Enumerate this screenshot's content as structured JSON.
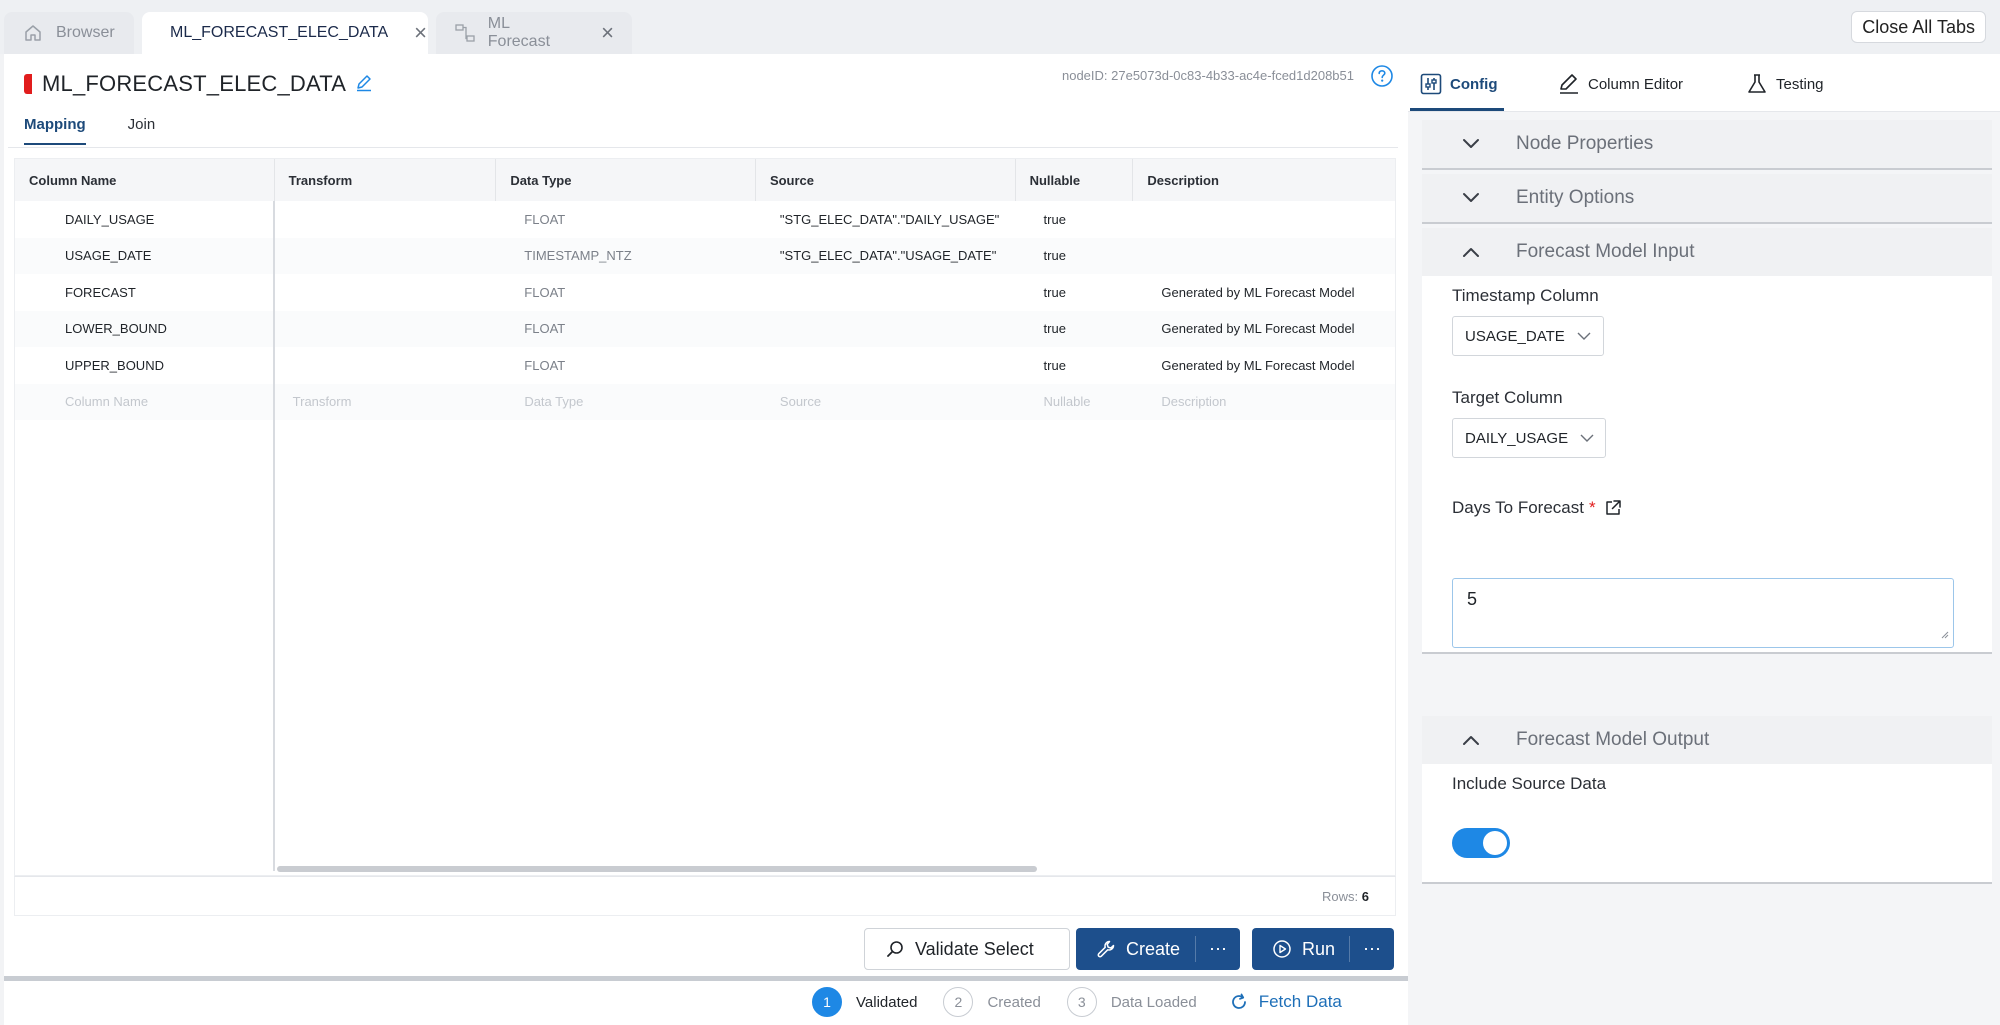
{
  "tabs": {
    "browser": "Browser",
    "active": "ML_FORECAST_ELEC_DATA",
    "ml_forecast": "ML Forecast",
    "close_all": "Close All Tabs"
  },
  "header": {
    "title": "ML_FORECAST_ELEC_DATA",
    "node_id": "nodeID: 27e5073d-0c83-4b33-ac4e-fced1d208b51"
  },
  "subtabs": {
    "mapping": "Mapping",
    "join": "Join"
  },
  "grid": {
    "columns": [
      "Column Name",
      "Transform",
      "Data Type",
      "Source",
      "Nullable",
      "Description"
    ],
    "rows": [
      {
        "name": "DAILY_USAGE",
        "transform": "",
        "type": "FLOAT",
        "source": "\"STG_ELEC_DATA\".\"DAILY_USAGE\"",
        "nullable": "true",
        "description": ""
      },
      {
        "name": "USAGE_DATE",
        "transform": "",
        "type": "TIMESTAMP_NTZ",
        "source": "\"STG_ELEC_DATA\".\"USAGE_DATE\"",
        "nullable": "true",
        "description": ""
      },
      {
        "name": "FORECAST",
        "transform": "",
        "type": "FLOAT",
        "source": "",
        "nullable": "true",
        "description": "Generated by ML Forecast Model"
      },
      {
        "name": "LOWER_BOUND",
        "transform": "",
        "type": "FLOAT",
        "source": "",
        "nullable": "true",
        "description": "Generated by ML Forecast Model"
      },
      {
        "name": "UPPER_BOUND",
        "transform": "",
        "type": "FLOAT",
        "source": "",
        "nullable": "true",
        "description": "Generated by ML Forecast Model"
      }
    ],
    "placeholder": {
      "name": "Column Name",
      "transform": "Transform",
      "type": "Data Type",
      "source": "Source",
      "nullable": "Nullable",
      "description": "Description"
    },
    "rows_label": "Rows:",
    "rows_count": "6"
  },
  "actions": {
    "validate": "Validate Select",
    "create": "Create",
    "run": "Run",
    "more": "⋯"
  },
  "status": {
    "steps": [
      {
        "num": "1",
        "label": "Validated"
      },
      {
        "num": "2",
        "label": "Created"
      },
      {
        "num": "3",
        "label": "Data Loaded"
      }
    ],
    "fetch": "Fetch Data"
  },
  "right": {
    "tabs": {
      "config": "Config",
      "column_editor": "Column Editor",
      "testing": "Testing"
    },
    "sections": {
      "node_properties": "Node Properties",
      "entity_options": "Entity Options",
      "forecast_input": "Forecast Model Input",
      "forecast_output": "Forecast Model Output"
    },
    "fields": {
      "timestamp_label": "Timestamp Column",
      "timestamp_value": "USAGE_DATE",
      "target_label": "Target Column",
      "target_value": "DAILY_USAGE",
      "days_label": "Days To Forecast",
      "days_required": "*",
      "days_value": "5",
      "include_label": "Include Source Data",
      "include_on": true
    }
  },
  "colors": {
    "accent": "#1d4f8c",
    "brand_red": "#e11d1d",
    "toggle": "#1e88e5"
  },
  "icons": [
    "home-icon",
    "close-icon",
    "lineage-icon",
    "pencil-icon",
    "help-icon",
    "config-icon",
    "column-editor-icon",
    "flask-icon",
    "chevron-down-icon",
    "chevron-up-icon",
    "magnifier-icon",
    "wrench-icon",
    "play-icon",
    "refresh-icon",
    "external-link-icon"
  ]
}
